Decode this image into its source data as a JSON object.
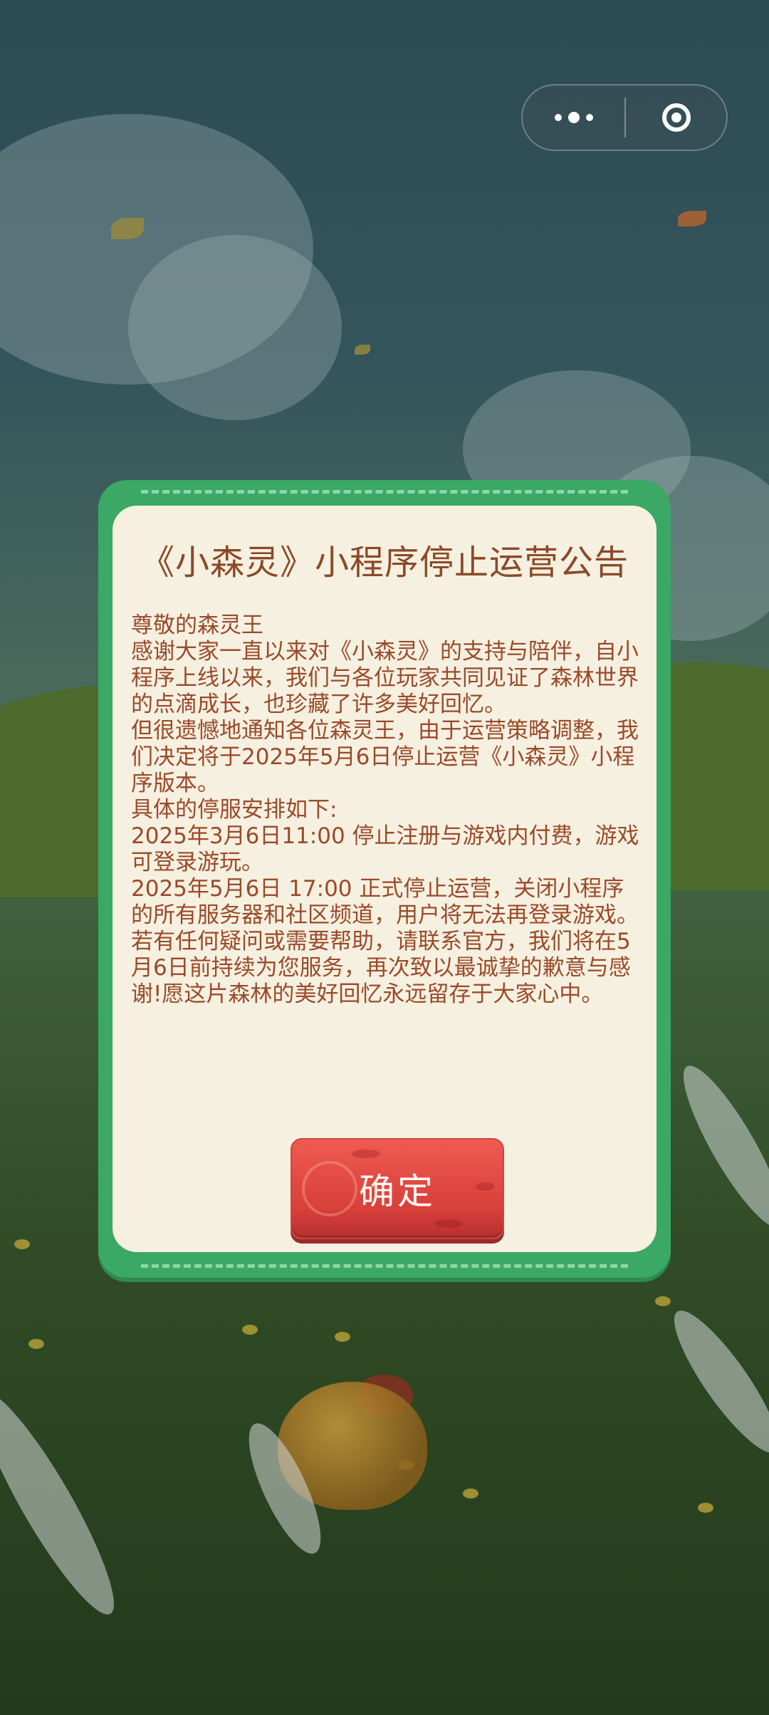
{
  "dialog": {
    "title": "《小森灵》小程序停止运营公告",
    "paragraphs": [
      "尊敬的森灵王",
      "感谢大家一直以来对《小森灵》的支持与陪伴，自小程序上线以来，我们与各位玩家共同见证了森林世界的点滴成长，也珍藏了许多美好回忆。",
      "但很遗憾地通知各位森灵王，由于运营策略调整，我们决定将于2025年5月6日停止运营《小森灵》小程序版本。",
      "具体的停服安排如下:",
      "2025年3月6日11:00 停止注册与游戏内付费，游戏可登录游玩。",
      "2025年5月6日 17:00 正式停止运营，关闭小程序的所有服务器和社区频道，用户将无法再登录游戏。",
      "若有任何疑问或需要帮助，请联系官方，我们将在5月6日前持续为您服务，再次致以最诚挚的歉意与感谢!愿这片森林的美好回忆永远留存于大家心中。"
    ],
    "confirm_label": "确定"
  },
  "capsule": {
    "more_icon": "more-dots-icon",
    "close_icon": "close-circle-icon"
  },
  "colors": {
    "dialog_border": "#3ba866",
    "dialog_bg": "#f6f0e0",
    "title_text": "#8a4a28",
    "body_text": "#9a4a2a",
    "button_red": "#e04a42"
  }
}
